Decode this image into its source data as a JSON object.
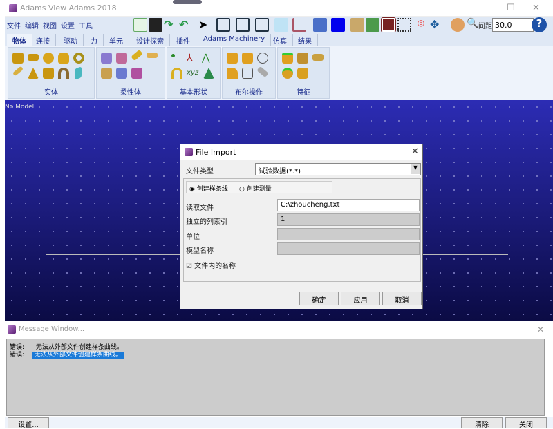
{
  "window": {
    "title": "Adams View Adams 2018",
    "minimize": "—",
    "maximize": "☐",
    "close": "✕"
  },
  "menu": [
    "文件",
    "编辑",
    "视图",
    "设置",
    "工具"
  ],
  "toolbar": {
    "distance_label": "间距",
    "distance_value": "30.0",
    "help": "?"
  },
  "tabs": [
    "物体",
    "连接",
    "驱动",
    "力",
    "单元",
    "设计探索",
    "插件",
    "Adams Machinery",
    "仿真",
    "结果"
  ],
  "ribbon_groups": [
    "实体",
    "柔性体",
    "基本形状",
    "布尔操作",
    "特征"
  ],
  "viewport": {
    "label": "No Model"
  },
  "dialog": {
    "title": "File Import",
    "file_type_label": "文件类型",
    "file_type_value": "试验数据(*.*)",
    "radio_spline": "创建样条线",
    "radio_measure": "创建测量",
    "read_file_label": "读取文件",
    "read_file_value": "C:\\zhoucheng.txt",
    "column_index_label": "独立的列索引",
    "column_index_value": "1",
    "units_label": "单位",
    "model_name_label": "模型名称",
    "names_in_file_label": "文件内的名称",
    "ok": "确定",
    "apply": "应用",
    "cancel": "取消",
    "close": "✕"
  },
  "message_window": {
    "title": "Message Window...",
    "close": "✕",
    "messages": [
      {
        "level": "错误:",
        "text": "无法从外部文件创建样条曲线。"
      },
      {
        "level": "错误:",
        "text": "无法从外部文件创建样条曲线。"
      }
    ],
    "settings": "设置...",
    "clear": "清除",
    "close_button": "关闭"
  }
}
